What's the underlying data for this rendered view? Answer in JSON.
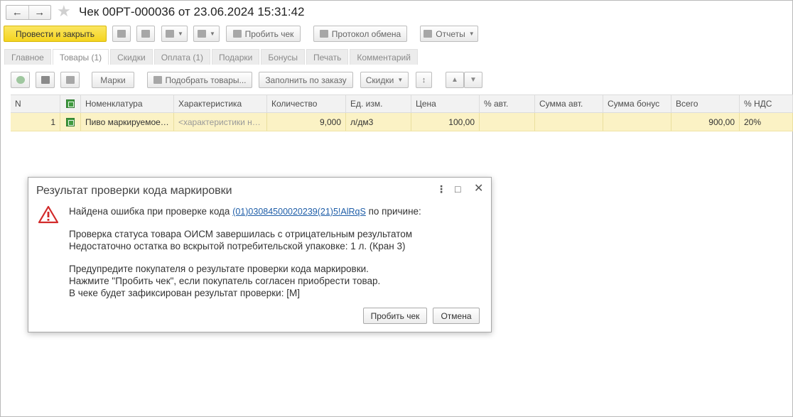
{
  "window": {
    "title": "Чек 00РТ-000036 от 23.06.2024 15:31:42",
    "back_icon": "arrow-left-icon",
    "forward_icon": "arrow-right-icon",
    "favorite_icon": "star-icon"
  },
  "toolbar": {
    "post_close_label": "Провести и закрыть",
    "print_check_label": "Пробить чек",
    "exchange_log_label": "Протокол обмена",
    "reports_label": "Отчеты"
  },
  "tabs": [
    {
      "label": "Главное",
      "active": false
    },
    {
      "label": "Товары (1)",
      "active": true
    },
    {
      "label": "Скидки",
      "active": false
    },
    {
      "label": "Оплата (1)",
      "active": false
    },
    {
      "label": "Подарки",
      "active": false
    },
    {
      "label": "Бонусы",
      "active": false
    },
    {
      "label": "Печать",
      "active": false
    },
    {
      "label": "Комментарий",
      "active": false
    }
  ],
  "goods_toolbar": {
    "marks_label": "Марки",
    "pick_goods_label": "Подобрать товары...",
    "fill_by_order_label": "Заполнить по заказу",
    "discounts_label": "Скидки"
  },
  "table": {
    "columns": [
      "N",
      "",
      "Номенклатура",
      "Характеристика",
      "Количество",
      "Ед. изм.",
      "Цена",
      "% авт.",
      "Сумма авт.",
      "Сумма бонус",
      "Всего",
      "% НДС"
    ],
    "rows": [
      {
        "n": "1",
        "item": "Пиво маркируемое…",
        "characteristic": "<характеристики н…",
        "quantity": "9,000",
        "unit": "л/дм3",
        "price": "100,00",
        "auto_pct": "",
        "auto_sum": "",
        "bonus_sum": "",
        "total": "900,00",
        "vat": "20%"
      }
    ]
  },
  "dialog": {
    "title": "Результат проверки кода маркировки",
    "line1_prefix": "Найдена ошибка при проверке кода",
    "code_link": "(01)03084500020239(21)5!AlRqS",
    "line1_suffix": "по причине:",
    "line2": "Проверка статуса товара ОИСМ завершилась с отрицательным результатом",
    "line3": "Недостаточно остатка во вскрытой потребительской упаковке: 1 л. (Кран 3)",
    "line4": "Предупредите покупателя о результате проверки кода маркировки.",
    "line5": "Нажмите \"Пробить чек\", если покупатель согласен приобрести товар.",
    "line6": "В чеке будет зафиксирован результат проверки: [M]",
    "confirm_label": "Пробить чек",
    "cancel_label": "Отмена"
  },
  "colors": {
    "primary_button": "#f4d41f",
    "selected_row": "#fbf2c5",
    "link": "#1f5ea8",
    "warning": "#d22a2a"
  }
}
